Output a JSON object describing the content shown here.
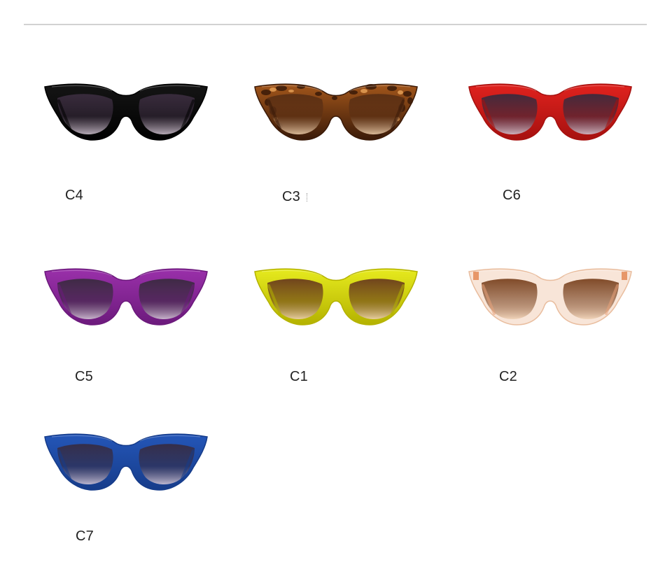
{
  "variants": [
    {
      "code": "C4",
      "frame_color": "#151515",
      "frame_edge": "#000000",
      "lens_top": "#3a2c3e",
      "lens_bottom": "#c9bcc9",
      "pattern": "solid"
    },
    {
      "code": "C3",
      "frame_color": "#a2561b",
      "frame_edge": "#3a1a08",
      "lens_top": "#5a2f14",
      "lens_bottom": "#e9c9a6",
      "pattern": "tortoise"
    },
    {
      "code": "C6",
      "frame_color": "#e0221e",
      "frame_edge": "#a6110f",
      "lens_top": "#3b2a3d",
      "lens_bottom": "#cfc0cd",
      "pattern": "solid"
    },
    {
      "code": "C5",
      "frame_color": "#9a30aa",
      "frame_edge": "#6c1a7c",
      "lens_top": "#3a2a40",
      "lens_bottom": "#d1c3d3",
      "pattern": "solid"
    },
    {
      "code": "C1",
      "frame_color": "#e6ea1e",
      "frame_edge": "#b4b200",
      "lens_top": "#6a3c1c",
      "lens_bottom": "#ecd0b0",
      "pattern": "solid"
    },
    {
      "code": "C2",
      "frame_color": "#f6dccb",
      "frame_edge": "#e9bd9e",
      "lens_top": "#7a4320",
      "lens_bottom": "#f0d2b6",
      "pattern": "transparent"
    },
    {
      "code": "C7",
      "frame_color": "#2456b8",
      "frame_edge": "#163c8a",
      "lens_top": "#362c44",
      "lens_bottom": "#cdc3d6",
      "pattern": "solid"
    }
  ]
}
